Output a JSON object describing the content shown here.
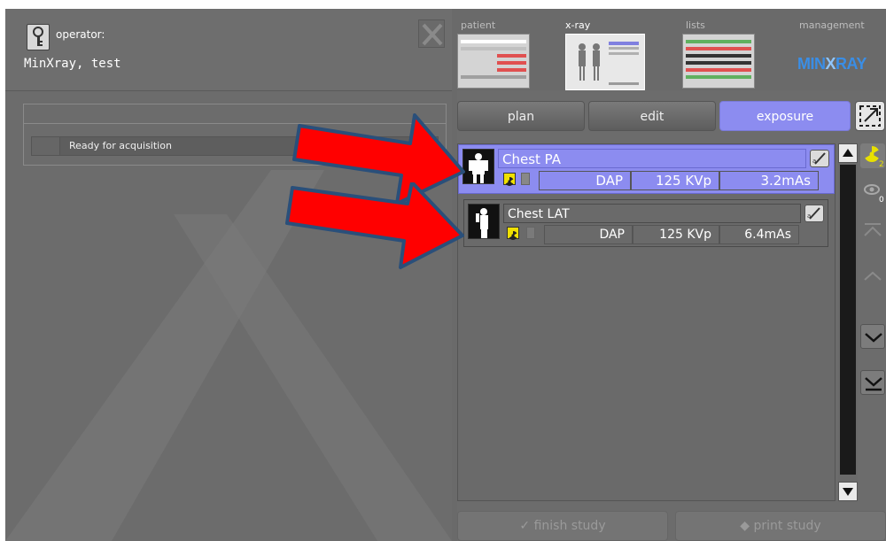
{
  "header": {
    "operator_label": "operator:",
    "operator_name": "MinXray, test"
  },
  "nav": {
    "patient": "patient",
    "xray": "x-ray",
    "lists": "lists",
    "management": "management",
    "brand_left": "MIN",
    "brand_x": "X",
    "brand_right": "RAY"
  },
  "status": {
    "text": "Ready for acquisition"
  },
  "tabs": [
    {
      "label": "plan"
    },
    {
      "label": "edit"
    },
    {
      "label": "exposure"
    }
  ],
  "procedures": [
    {
      "name": "Chest PA",
      "dap": "DAP",
      "kvp": "125 KVp",
      "mas": "3.2mAs"
    },
    {
      "name": "Chest LAT",
      "dap": "DAP",
      "kvp": "125 KVp",
      "mas": "6.4mAs"
    }
  ],
  "side_counts": {
    "radiation": "2",
    "eye": "0"
  },
  "footer": {
    "finish_label": "finish study",
    "print_label": "print study"
  },
  "colors": {
    "accent": "#8c8cf0",
    "arrow_red": "#ff0000",
    "arrow_border": "#2a4f7a",
    "radiation_yellow": "#f0e000"
  }
}
